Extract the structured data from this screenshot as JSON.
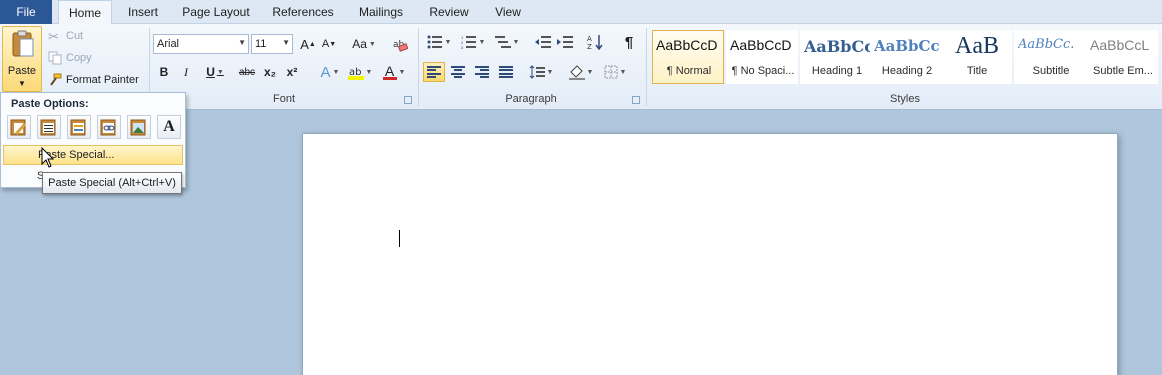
{
  "tabs": {
    "file": "File",
    "items": [
      "Home",
      "Insert",
      "Page Layout",
      "References",
      "Mailings",
      "Review",
      "View"
    ],
    "active": "Home"
  },
  "clipboard": {
    "paste_label": "Paste",
    "cut_label": "Cut",
    "copy_label": "Copy",
    "format_painter_label": "Format Painter"
  },
  "font": {
    "group_label": "Font",
    "font_name": "Arial",
    "font_size": "11",
    "grow_label": "A",
    "shrink_label": "A",
    "change_case_label": "Aa",
    "bold": "B",
    "italic": "I",
    "underline": "U",
    "strikethrough": "abc",
    "subscript": "x₂",
    "superscript": "x²",
    "text_effects": "A",
    "font_color_label": "A",
    "font_color": "#d22828",
    "highlight_color": "#f5f500"
  },
  "paragraph": {
    "group_label": "Paragraph",
    "show_marks": "¶"
  },
  "styles": {
    "group_label": "Styles",
    "items": [
      {
        "preview": "AaBbCcD",
        "name": "¶ Normal",
        "selected": true
      },
      {
        "preview": "AaBbCcD",
        "name": "¶ No Spaci..."
      },
      {
        "preview": "AaBbCc",
        "name": "Heading 1"
      },
      {
        "preview": "AaBbCc",
        "name": "Heading 2"
      },
      {
        "preview": "AaB",
        "name": "Title"
      },
      {
        "preview": "AaBbCc.",
        "name": "Subtitle"
      },
      {
        "preview": "AaBbCcL",
        "name": "Subtle Em..."
      }
    ]
  },
  "paste_menu": {
    "options_label": "Paste Options:",
    "paste_special_label": "Paste Special...",
    "partial_item": "S",
    "tooltip": "Paste Special (Alt+Ctrl+V)"
  },
  "colors": {
    "file_tab": "#2b5797",
    "ribbon_bg": "#e3ecf7",
    "highlight": "#fde38a",
    "workspace": "#afc6dc"
  }
}
